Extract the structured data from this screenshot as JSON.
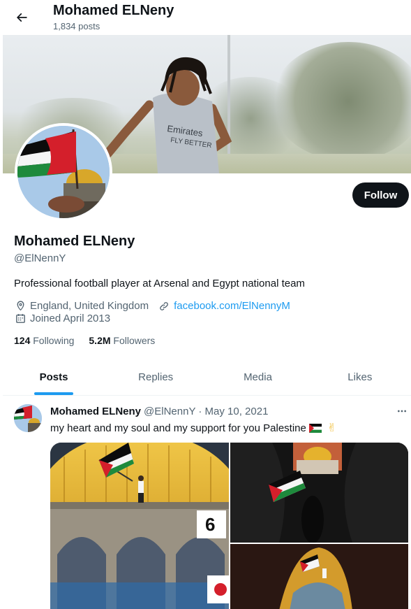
{
  "header": {
    "title": "Mohamed ELNeny",
    "posts_count": "1,834 posts"
  },
  "profile": {
    "name": "Mohamed ELNeny",
    "handle": "@ElNennY",
    "bio": "Professional football player at Arsenal and Egypt national team",
    "location": "England, United Kingdom",
    "website": "facebook.com/ElNennyM",
    "joined": "Joined April 2013",
    "following_count": "124",
    "following_label": "Following",
    "followers_count": "5.2M",
    "followers_label": "Followers",
    "follow_button": "Follow"
  },
  "tabs": [
    {
      "label": "Posts",
      "active": true
    },
    {
      "label": "Replies",
      "active": false
    },
    {
      "label": "Media",
      "active": false
    },
    {
      "label": "Likes",
      "active": false
    }
  ],
  "tweet": {
    "author_name": "Mohamed ELNeny",
    "author_handle_date": "@ElNennY · May 10, 2021",
    "text": "my heart and my soul and my support for you  Palestine",
    "emoji": "✌"
  },
  "colors": {
    "accent": "#1d9bf0",
    "text": "#0f1419",
    "muted": "#536471",
    "button": "#0f1419"
  }
}
